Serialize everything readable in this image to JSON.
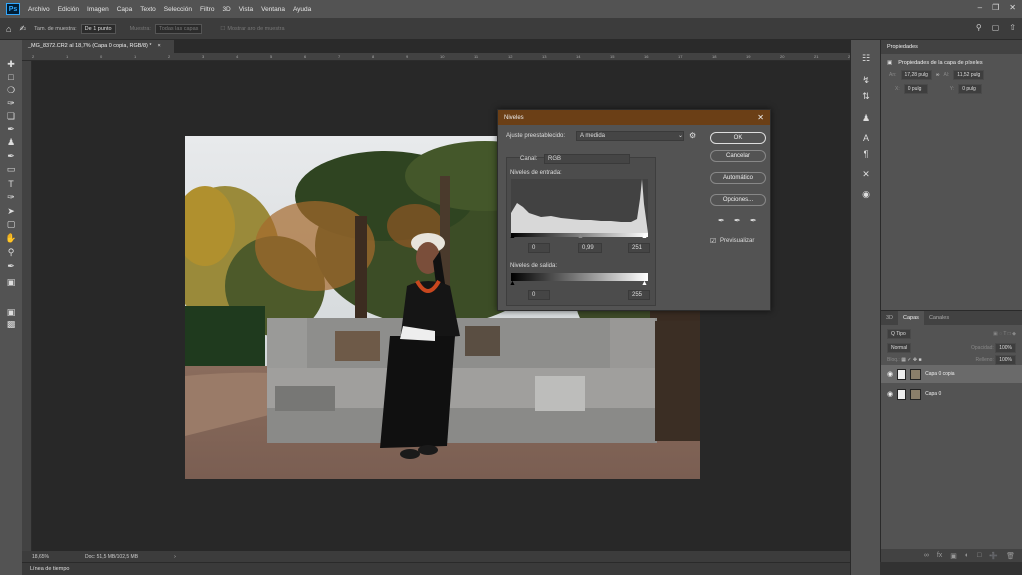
{
  "menubar": {
    "items": [
      "Archivo",
      "Edición",
      "Imagen",
      "Capa",
      "Texto",
      "Selección",
      "Filtro",
      "3D",
      "Vista",
      "Ventana",
      "Ayuda"
    ],
    "logo": "Ps",
    "icons": [
      "minimize-icon",
      "restore-icon",
      "close-icon"
    ]
  },
  "options": {
    "sample_size_label": "Tam. de muestra:",
    "sample_size_value": "De 1 punto",
    "sample_label": "Muestra:",
    "sample_value": "Todas las capas",
    "show_ring_label": "Mostrar aro de muestra"
  },
  "document": {
    "tab_title": "_MG_8372.CR2 al 18,7% (Capa 0 copia, RGB/8) *",
    "ruler_ticks": [
      "2",
      "1",
      "0",
      "1",
      "2",
      "3",
      "4",
      "5",
      "6",
      "7",
      "8",
      "9",
      "10",
      "11",
      "12",
      "13",
      "14",
      "15",
      "16",
      "17",
      "18",
      "19",
      "20",
      "21",
      "22"
    ]
  },
  "status": {
    "zoom": "18,65%",
    "doc": "Doc: 51,5 MB/102,5 MB"
  },
  "timeline": {
    "label": "Línea de tiempo"
  },
  "properties": {
    "tab": "Propiedades",
    "subtitle": "Propiedades de la capa de píxeles",
    "an_label": "An:",
    "an_value": "17,28 pulg",
    "link_icon": "link-icon",
    "al_label": "Al:",
    "al_value": "11,52 pulg",
    "x_label": "X:",
    "x_value": "0 pulg",
    "y_label": "Y:",
    "y_value": "0 pulg"
  },
  "layers": {
    "tabs": [
      "3D",
      "Capas",
      "Canales"
    ],
    "active_tab": "Capas",
    "filter_label": "Q Tipo",
    "blend_mode": "Normal",
    "opacity_label": "Opacidad:",
    "opacity_value": "100%",
    "lock_label": "Bloq.:",
    "fill_label": "Relleno:",
    "fill_value": "100%",
    "items": [
      {
        "name": "Capa 0 copia",
        "selected": true
      },
      {
        "name": "Capa 0",
        "selected": false
      }
    ]
  },
  "levels": {
    "title": "Niveles",
    "preset_label": "Ajuste preestablecido:",
    "preset_value": "A medida",
    "channel_label": "Canal:",
    "channel_value": "RGB",
    "input_label": "Niveles de entrada:",
    "input_black": "0",
    "input_gamma": "0,99",
    "input_white": "251",
    "output_label": "Niveles de salida:",
    "output_black": "0",
    "output_white": "255",
    "buttons": {
      "ok": "OK",
      "cancel": "Cancelar",
      "auto": "Automático",
      "options": "Opciones..."
    },
    "preview_label": "Previsualizar",
    "preview_checked": true
  },
  "colors": {
    "dialog_title_bg": "#6b3f16",
    "app_bg": "#535353",
    "canvas_bg": "#282828"
  }
}
